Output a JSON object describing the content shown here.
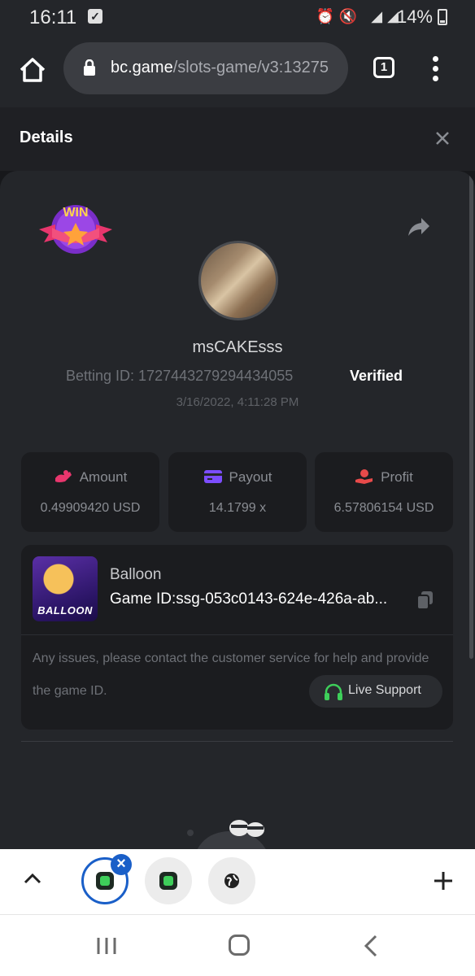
{
  "status_bar": {
    "time": "16:11",
    "battery": "14%"
  },
  "browser": {
    "url_host": "bc.game",
    "url_path": "/slots-game/v3:13275",
    "tab_count": "1"
  },
  "header": {
    "title": "Details"
  },
  "bet": {
    "win_badge": "WIN",
    "username": "msCAKEsss",
    "betting_id": "Betting ID: 1727443279294434055",
    "verified": "Verified",
    "timestamp": "3/16/2022, 4:11:28 PM"
  },
  "stats": {
    "amount": {
      "label": "Amount",
      "value": "0.49909420 USD"
    },
    "payout": {
      "label": "Payout",
      "value": "14.1799 x"
    },
    "profit": {
      "label": "Profit",
      "value": "6.57806154 USD"
    }
  },
  "game": {
    "name": "Balloon",
    "thumb_label": "BALLOON",
    "game_id": "Game ID:ssg-053c0143-624e-426a-ab...",
    "help_text": "Any issues, please contact the customer service for help and provide the game ID.",
    "live_support": "Live Support"
  },
  "colors": {
    "accent_pink": "#e8366d",
    "accent_purple": "#7c4dff",
    "accent_red": "#e84a4a",
    "support_green": "#3ecf5a",
    "active_tab_blue": "#1a5fc8"
  }
}
